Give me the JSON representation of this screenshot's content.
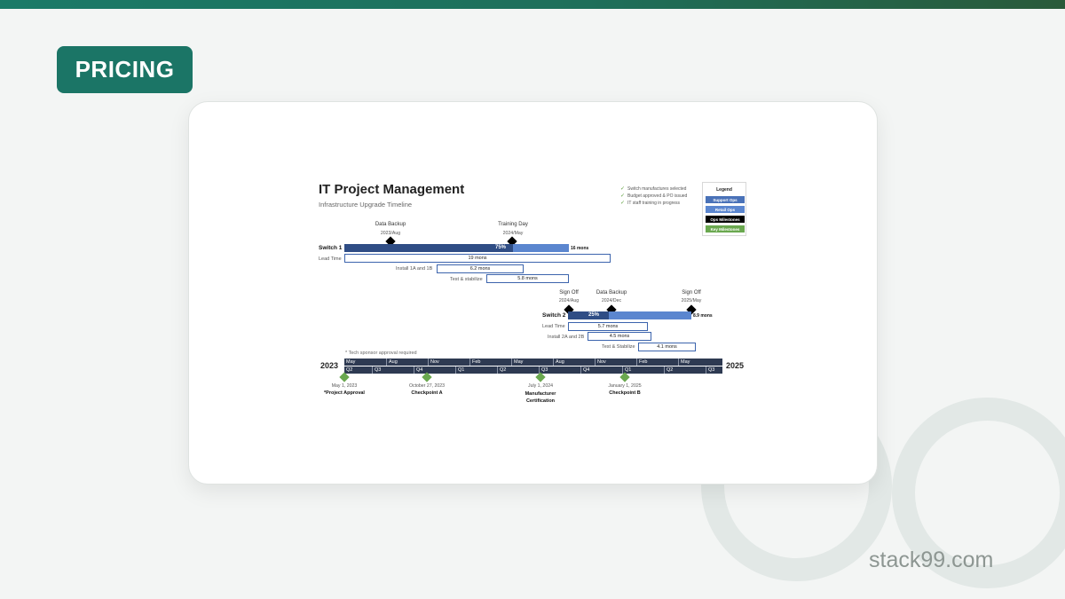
{
  "page": {
    "badge": "PRICING",
    "brand": "stack99.com"
  },
  "doc": {
    "title": "IT Project Management",
    "subtitle": "Infrastructure Upgrade Timeline",
    "checklist": [
      "Switch manufactures selected",
      "Budget approved & PO issued",
      "IT staff training in progress"
    ],
    "legend": {
      "title": "Legend",
      "items": [
        {
          "label": "Support Ops",
          "color": "#4a72b8"
        },
        {
          "label": "Retail Ops",
          "color": "#5b86cf"
        },
        {
          "label": "Ops Milestones",
          "color": "#000000"
        },
        {
          "label": "Key Milestones",
          "color": "#6aa84f"
        }
      ]
    },
    "switch1": {
      "label": "Switch 1",
      "progress": "75%",
      "progress_value": 75,
      "duration": "16 mons",
      "milestones": [
        {
          "name": "Data Backup",
          "date": "2023/Aug"
        },
        {
          "name": "Training Day",
          "date": "2024/May"
        }
      ],
      "tasks": [
        {
          "name": "Lead Time",
          "duration": "19 mons"
        },
        {
          "name": "Install 1A and 1B",
          "duration": "6.2 mons"
        },
        {
          "name": "Test & stabilize",
          "duration": "5.8 mons"
        }
      ]
    },
    "switch2": {
      "label": "Switch 2",
      "progress": "25%",
      "progress_value": 25,
      "duration": "8.9 mons",
      "milestones": [
        {
          "name": "Sign Off",
          "date": "2024/Aug"
        },
        {
          "name": "Data Backup",
          "date": "2024/Dec"
        },
        {
          "name": "Sign Off",
          "date": "2025/May"
        }
      ],
      "tasks": [
        {
          "name": "Lead Time",
          "duration": "5.7 mons"
        },
        {
          "name": "Install 2A and 2B",
          "duration": "4.5 mons"
        },
        {
          "name": "Test & Stabilize",
          "duration": "4.1 mons"
        }
      ]
    },
    "note": "* Tech sponsor approval required",
    "timeline": {
      "start_year": "2023",
      "end_year": "2025",
      "months": [
        "May",
        "Aug",
        "Nov",
        "Feb",
        "May",
        "Aug",
        "Nov",
        "Feb",
        "May"
      ],
      "quarters": [
        "Q2",
        "Q3",
        "Q4",
        "Q1",
        "Q2",
        "Q3",
        "Q4",
        "Q1",
        "Q2",
        "Q3"
      ]
    },
    "key_milestones": [
      {
        "date": "May 1, 2023",
        "name": "*Project Approval"
      },
      {
        "date": "October 27, 2023",
        "name": "Checkpoint A"
      },
      {
        "date": "July 1, 2024",
        "name": "Manufacturer Certification"
      },
      {
        "date": "January 1, 2025",
        "name": "Checkpoint B"
      }
    ]
  }
}
